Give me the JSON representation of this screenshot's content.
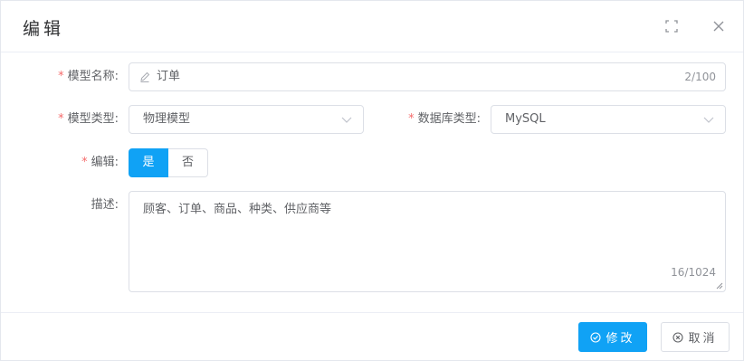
{
  "dialog": {
    "title": "编辑",
    "fullscreen_icon": "fullscreen-icon",
    "close_icon": "close-icon"
  },
  "form": {
    "model_name": {
      "label": "模型名称:",
      "value": "订单",
      "counter": "2/100",
      "icon": "pencil-icon"
    },
    "model_type": {
      "label": "模型类型:",
      "value": "物理模型"
    },
    "db_type": {
      "label": "数据库类型:",
      "value": "MySQL"
    },
    "editable": {
      "label": "编辑:",
      "options": [
        "是",
        "否"
      ],
      "selected": "是"
    },
    "description": {
      "label": "描述:",
      "value": "顾客、订单、商品、种类、供应商等",
      "counter": "16/1024"
    },
    "required_mark": "*"
  },
  "footer": {
    "submit_label": "修改",
    "cancel_label": "取消"
  },
  "colors": {
    "primary": "#10a2f5",
    "required": "#f56c6c"
  }
}
